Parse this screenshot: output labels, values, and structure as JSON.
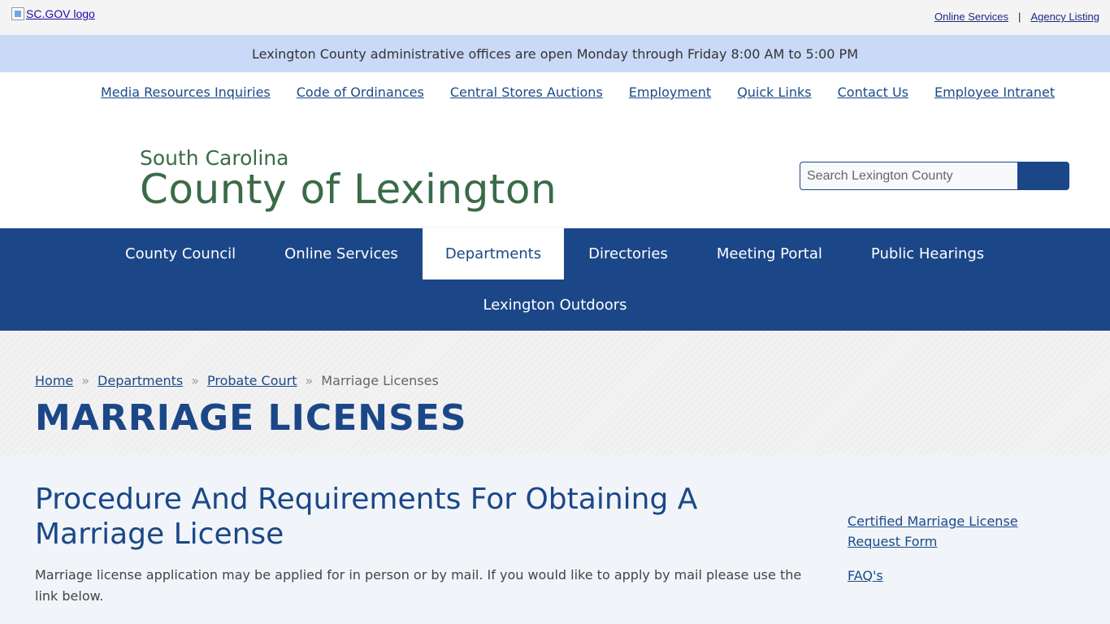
{
  "util_bar": {
    "logo_alt": "SC.GOV logo",
    "links": [
      "Online Services",
      "Agency Listing"
    ],
    "separator": "|"
  },
  "alert": {
    "text": "Lexington County administrative offices are open Monday through Friday 8:00 AM to 5:00 PM"
  },
  "secondary_nav": {
    "items": [
      "Media Resources Inquiries",
      "Code of Ordinances",
      "Central Stores Auctions",
      "Employment",
      "Quick Links",
      "Contact Us",
      "Employee Intranet"
    ]
  },
  "brand": {
    "state": "South Carolina",
    "name": "County of Lexington"
  },
  "search": {
    "placeholder": "Search Lexington County",
    "icon": "search-icon"
  },
  "main_nav": {
    "items": [
      "County Council",
      "Online Services",
      "Departments",
      "Directories",
      "Meeting Portal",
      "Public Hearings"
    ],
    "active": "Departments",
    "row2": [
      "Lexington Outdoors"
    ]
  },
  "breadcrumb": {
    "items": [
      "Home",
      "Departments",
      "Probate Court"
    ],
    "current": "Marriage Licenses",
    "separator": "»"
  },
  "page": {
    "title": "MARRIAGE LICENSES",
    "heading": "Procedure And Requirements For Obtaining A Marriage License",
    "body": "Marriage license application may be applied for in person or by mail.  If you would like to apply by mail please use the link below."
  },
  "sidebar": {
    "links": [
      "Certified Marriage License Request Form",
      "FAQ's"
    ]
  },
  "colors": {
    "primary": "#1b4788",
    "brand_green": "#3a6b47",
    "alert_bg": "#c9daf8",
    "content_bg": "#f1f4f8"
  }
}
